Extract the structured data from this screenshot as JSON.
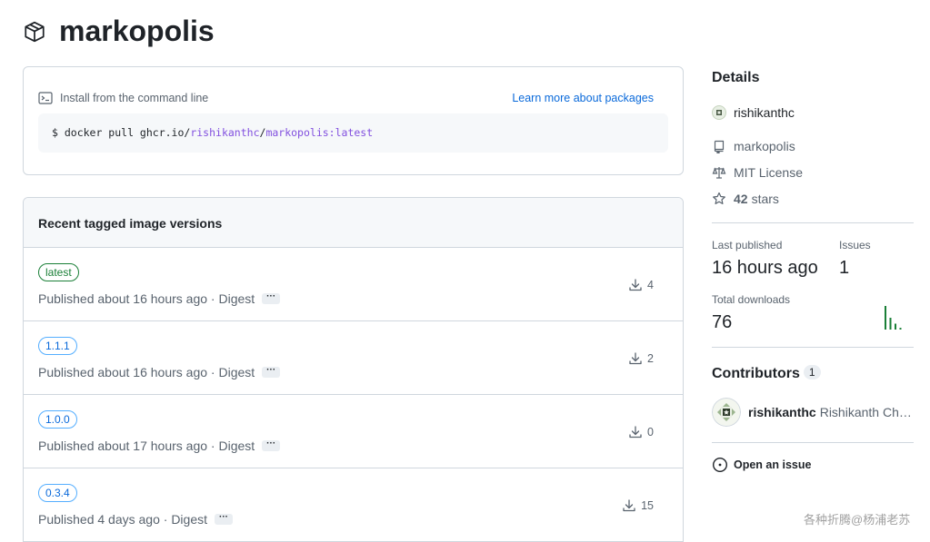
{
  "header": {
    "title": "markopolis",
    "icon": "package-icon"
  },
  "install": {
    "label": "Install from the command line",
    "learn_more": "Learn more about packages",
    "command_prefix": "$ docker pull ghcr.io/",
    "command_owner": "rishikanthc",
    "command_sep": "/",
    "command_image": "markopolis:latest"
  },
  "versions": {
    "heading": "Recent tagged image versions",
    "rows": [
      {
        "tag": "latest",
        "published": "Published about 16 hours ago · Digest",
        "downloads": "4"
      },
      {
        "tag": "1.1.1",
        "published": "Published about 16 hours ago · Digest",
        "downloads": "2"
      },
      {
        "tag": "1.0.0",
        "published": "Published about 17 hours ago · Digest",
        "downloads": "0"
      },
      {
        "tag": "0.3.4",
        "published": "Published 4 days ago · Digest",
        "downloads": "15"
      }
    ],
    "more_label": "···"
  },
  "details": {
    "title": "Details",
    "owner": "rishikanthc",
    "repo": "markopolis",
    "license": "MIT License",
    "stars_count": "42",
    "stars_label": "stars"
  },
  "stats": {
    "last_published_label": "Last published",
    "last_published_value": "16 hours ago",
    "issues_label": "Issues",
    "issues_value": "1",
    "total_downloads_label": "Total downloads",
    "total_downloads_value": "76",
    "spark_values": [
      4,
      2,
      1,
      0.3
    ]
  },
  "contributors": {
    "title": "Contributors",
    "count": "1",
    "items": [
      {
        "login": "rishikanthc",
        "name": "Rishikanth Chandrasekaran"
      }
    ]
  },
  "open_issue": {
    "label": "Open an issue"
  },
  "watermark": "各种折腾@杨浦老苏",
  "colors": {
    "accent": "#0969da",
    "success": "#1a7f37",
    "purple": "#8250df",
    "border": "#d0d7de"
  }
}
